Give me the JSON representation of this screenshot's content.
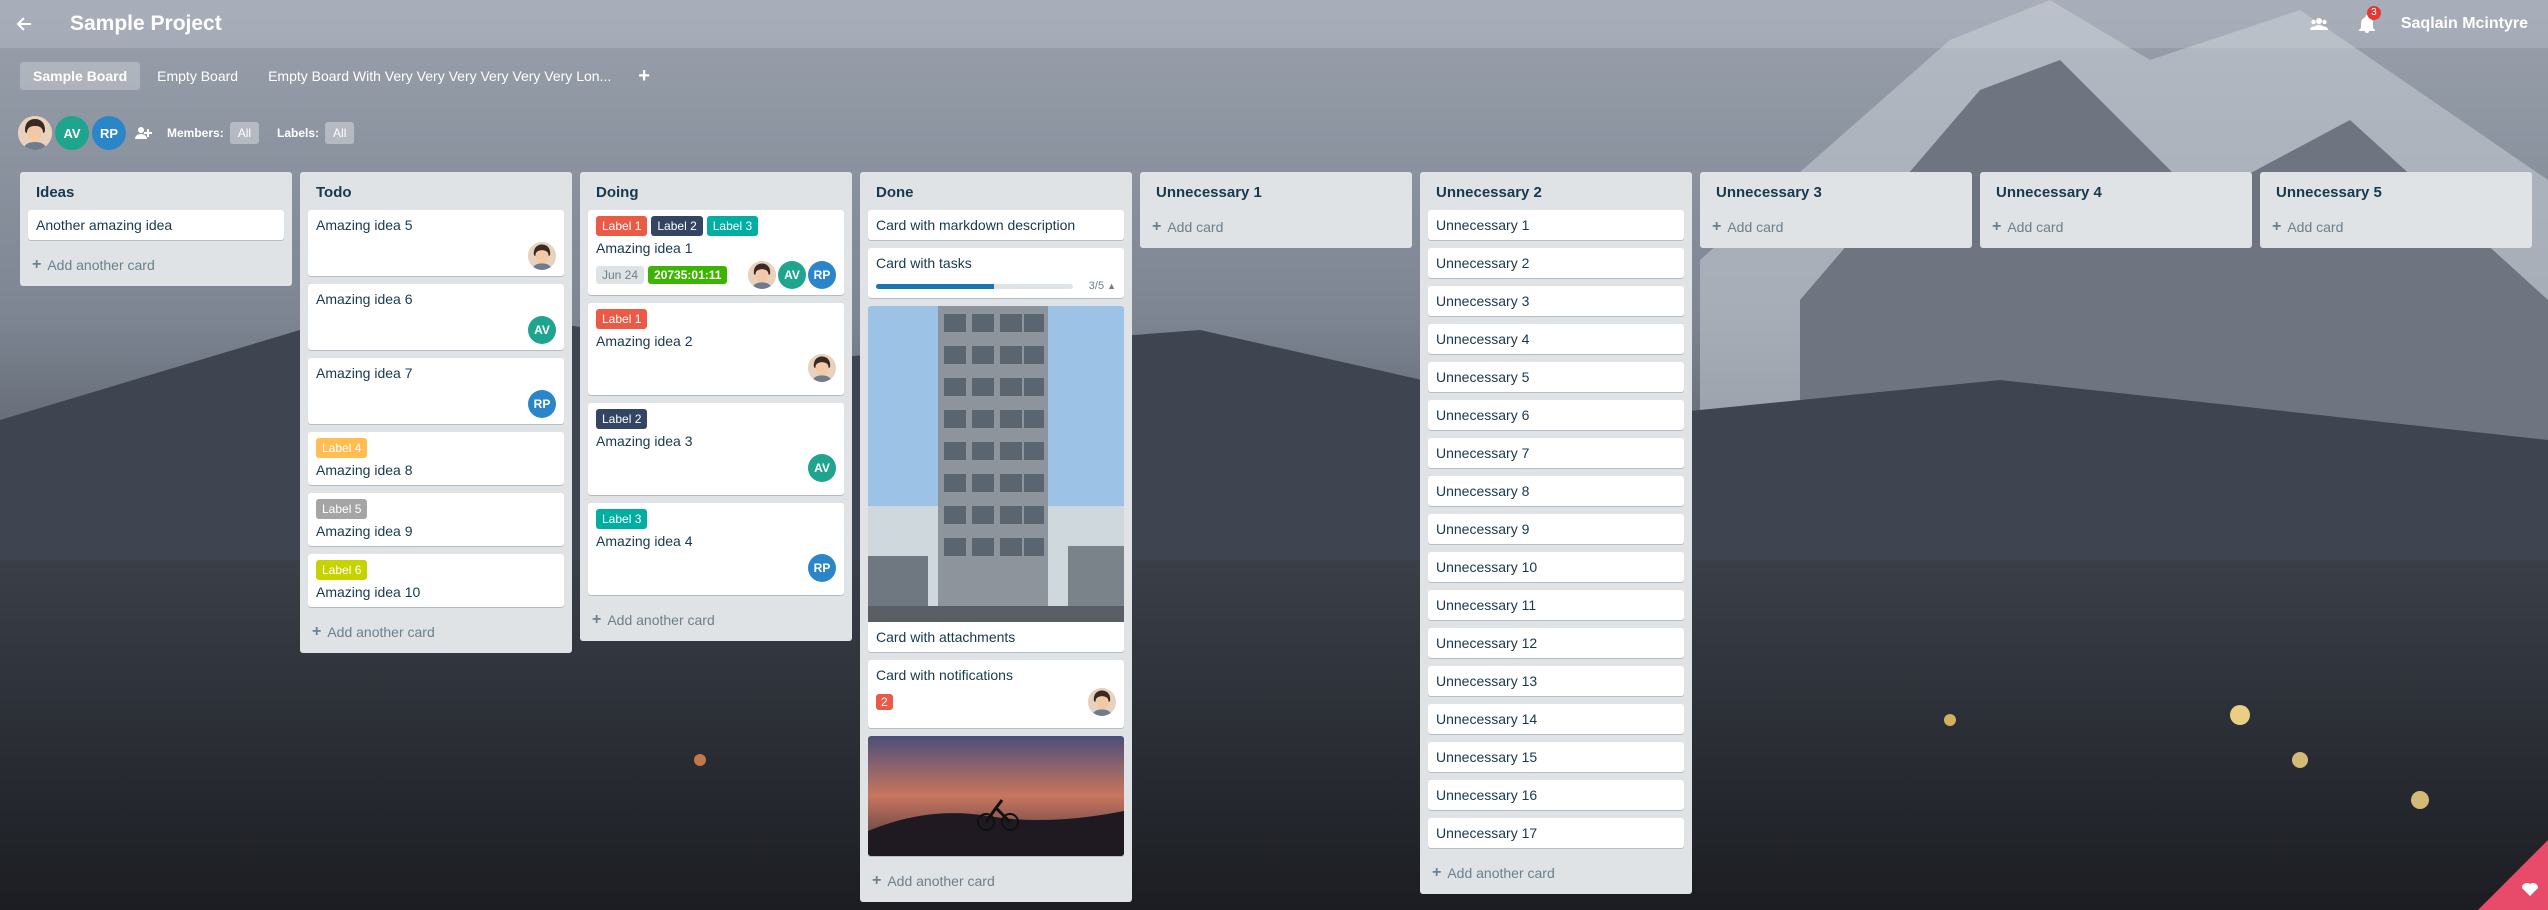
{
  "header": {
    "project_title": "Sample Project",
    "notification_count": "3",
    "user_name": "Saqlain Mcintyre"
  },
  "tabs": [
    {
      "label": "Sample Board",
      "active": true
    },
    {
      "label": "Empty Board",
      "active": false
    },
    {
      "label": "Empty Board With Very Very Very Very Very Very Lon...",
      "active": false
    }
  ],
  "tab_add": "+",
  "filters": {
    "members_label": "Members:",
    "members_value": "All",
    "labels_label": "Labels:",
    "labels_value": "All",
    "avatars": [
      "AV",
      "RP"
    ]
  },
  "label_colors": {
    "Label 1": "#eb5a46",
    "Label 2": "#344563",
    "Label 3": "#00aea2",
    "Label 4": "#ffbe4f",
    "Label 5": "#a5a5a5",
    "Label 6": "#c7d300"
  },
  "lists": {
    "ideas": {
      "title": "Ideas",
      "cards": [
        "Another amazing idea"
      ],
      "add": "Add another card"
    },
    "todo": {
      "title": "Todo",
      "cards": [
        {
          "title": "Amazing idea 5"
        },
        {
          "title": "Amazing idea 6",
          "avatar": "AV"
        },
        {
          "title": "Amazing idea 7",
          "avatar": "RP"
        },
        {
          "title": "Amazing idea 8",
          "label": "Label 4"
        },
        {
          "title": "Amazing idea 9",
          "label": "Label 5"
        },
        {
          "title": "Amazing idea 10",
          "label": "Label 6"
        }
      ],
      "add": "Add another card"
    },
    "doing": {
      "title": "Doing",
      "cards": [
        {
          "title": "Amazing idea 1",
          "labels": [
            "Label 1",
            "Label 2",
            "Label 3"
          ],
          "date": "Jun 24",
          "timer": "20735:01:11",
          "avatars": [
            "AV",
            "RP"
          ]
        },
        {
          "title": "Amazing idea 2",
          "label": "Label 1"
        },
        {
          "title": "Amazing idea 3",
          "label": "Label 2",
          "avatar": "AV"
        },
        {
          "title": "Amazing idea 4",
          "label": "Label 3",
          "avatar": "RP"
        }
      ],
      "add": "Add another card"
    },
    "done": {
      "title": "Done",
      "cards": {
        "markdown": "Card with markdown description",
        "tasks": "Card with tasks",
        "tasks_count": "3/5",
        "tasks_progress": 0.6,
        "attachments": "Card with attachments",
        "notifications": "Card with notifications",
        "notifications_count": "2"
      },
      "add": "Add another card"
    },
    "unnecessary_1": {
      "title": "Unnecessary 1",
      "add": "Add card"
    },
    "unnecessary_2": {
      "title": "Unnecessary 2",
      "cards": [
        "Unnecessary 1",
        "Unnecessary 2",
        "Unnecessary 3",
        "Unnecessary 4",
        "Unnecessary 5",
        "Unnecessary 6",
        "Unnecessary 7",
        "Unnecessary 8",
        "Unnecessary 9",
        "Unnecessary 10",
        "Unnecessary 11",
        "Unnecessary 12",
        "Unnecessary 13",
        "Unnecessary 14",
        "Unnecessary 15",
        "Unnecessary 16",
        "Unnecessary 17"
      ],
      "add": "Add another card"
    },
    "unnecessary_3": {
      "title": "Unnecessary 3",
      "add": "Add card"
    },
    "unnecessary_4": {
      "title": "Unnecessary 4",
      "add": "Add card"
    },
    "unnecessary_5": {
      "title": "Unnecessary 5",
      "add": "Add card"
    }
  }
}
